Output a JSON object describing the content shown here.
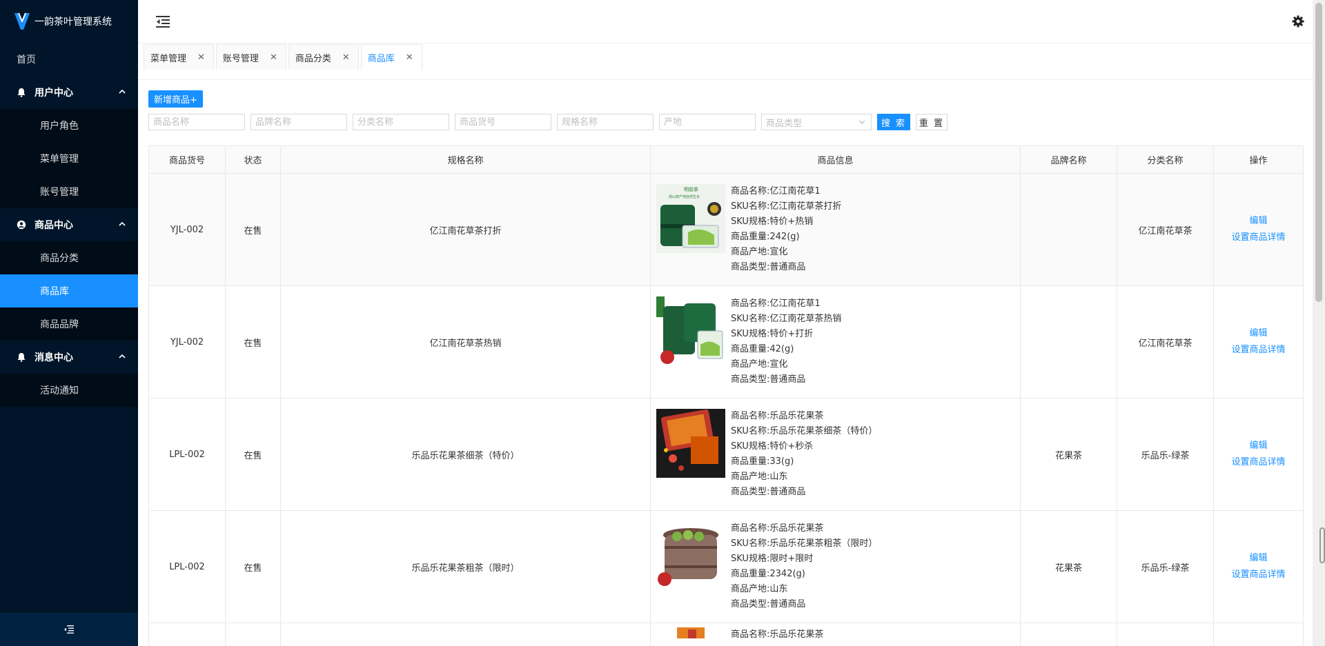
{
  "app": {
    "title": "一韵茶叶管理系统"
  },
  "sidebar": {
    "home": "首页",
    "groups": [
      {
        "label": "用户中心",
        "items": [
          "用户角色",
          "菜单管理",
          "账号管理"
        ]
      },
      {
        "label": "商品中心",
        "items": [
          "商品分类",
          "商品库",
          "商品品牌"
        ]
      },
      {
        "label": "消息中心",
        "items": [
          "活动通知"
        ]
      }
    ],
    "active_item": "商品库"
  },
  "tabs": [
    {
      "label": "菜单管理",
      "active": false
    },
    {
      "label": "账号管理",
      "active": false
    },
    {
      "label": "商品分类",
      "active": false
    },
    {
      "label": "商品库",
      "active": true
    }
  ],
  "toolbar": {
    "add_label": "新增商品+",
    "search_label": "搜 索",
    "reset_label": "重 置"
  },
  "filters": {
    "product_name": "商品名称",
    "brand_name": "品牌名称",
    "category_name": "分类名称",
    "product_code": "商品货号",
    "spec_name": "规格名称",
    "origin": "产地",
    "product_type": "商品类型"
  },
  "table": {
    "headers": [
      "商品货号",
      "状态",
      "规格名称",
      "商品信息",
      "品牌名称",
      "分类名称",
      "操作"
    ],
    "rows": [
      {
        "code": "YJL-002",
        "status": "在售",
        "spec": "亿江南花草茶打折",
        "info": [
          "商品名称:亿江南花草1",
          "SKU名称:亿江南花草茶打折",
          "SKU规格:特价+热销",
          "商品重量:242(g)",
          "商品产地:宣化",
          "商品类型:普通商品"
        ],
        "brand": "",
        "category": "亿江南花草茶",
        "edit": "编辑",
        "detail": "设置商品详情"
      },
      {
        "code": "YJL-002",
        "status": "在售",
        "spec": "亿江南花草茶热销",
        "info": [
          "商品名称:亿江南花草1",
          "SKU名称:亿江南花草茶热销",
          "SKU规格:特价+打折",
          "商品重量:42(g)",
          "商品产地:宣化",
          "商品类型:普通商品"
        ],
        "brand": "",
        "category": "亿江南花草茶",
        "edit": "编辑",
        "detail": "设置商品详情"
      },
      {
        "code": "LPL-002",
        "status": "在售",
        "spec": "乐品乐花果茶细茶（特价）",
        "info": [
          "商品名称:乐品乐花果茶",
          "SKU名称:乐品乐花果茶细茶（特价）",
          "SKU规格:特价+秒杀",
          "商品重量:33(g)",
          "商品产地:山东",
          "商品类型:普通商品"
        ],
        "brand": "花果茶",
        "category": "乐品乐-绿茶",
        "edit": "编辑",
        "detail": "设置商品详情"
      },
      {
        "code": "LPL-002",
        "status": "在售",
        "spec": "乐品乐花果茶粗茶（限时）",
        "info": [
          "商品名称:乐品乐花果茶",
          "SKU名称:乐品乐花果茶粗茶（限时）",
          "SKU规格:限时+限时",
          "商品重量:2342(g)",
          "商品产地:山东",
          "商品类型:普通商品"
        ],
        "brand": "花果茶",
        "category": "乐品乐-绿茶",
        "edit": "编辑",
        "detail": "设置商品详情"
      }
    ],
    "partial_row": {
      "info_first": "商品名称:乐品乐花果茶"
    }
  },
  "icons": [
    "logo-icon",
    "menu-fold-icon",
    "gear-icon",
    "bell-icon",
    "user-circle-icon",
    "close-icon",
    "chevron-up-icon",
    "chevron-down-icon"
  ],
  "colors": {
    "sidebar_bg": "#001529",
    "submenu_bg": "#000c17",
    "accent": "#1890ff"
  }
}
